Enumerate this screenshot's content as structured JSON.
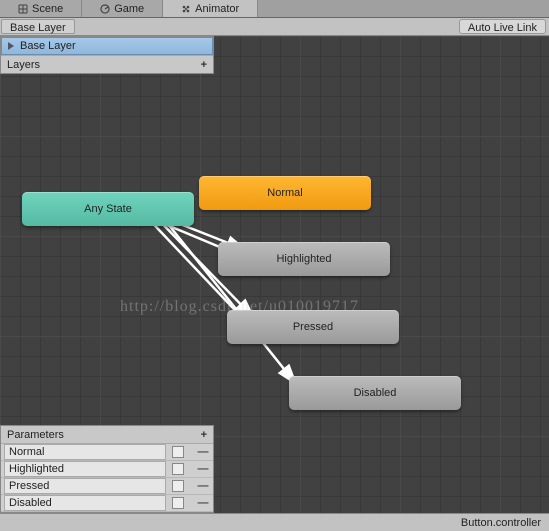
{
  "tabs": {
    "scene": "Scene",
    "game": "Game",
    "animator": "Animator"
  },
  "toolbar": {
    "breadcrumb": "Base Layer",
    "autoLiveLink": "Auto Live Link"
  },
  "layerPanel": {
    "current": "Base Layer",
    "title": "Layers"
  },
  "nodes": {
    "anyState": "Any State",
    "normal": "Normal",
    "highlighted": "Highlighted",
    "pressed": "Pressed",
    "disabled": "Disabled"
  },
  "paramPanel": {
    "title": "Parameters",
    "items": [
      {
        "name": "Normal"
      },
      {
        "name": "Highlighted"
      },
      {
        "name": "Pressed"
      },
      {
        "name": "Disabled"
      }
    ]
  },
  "statusBar": {
    "file": "Button.controller"
  },
  "watermark": "http://blog.csdn.net/u010019717",
  "glyphs": {
    "plus": "+",
    "dash": "—"
  }
}
